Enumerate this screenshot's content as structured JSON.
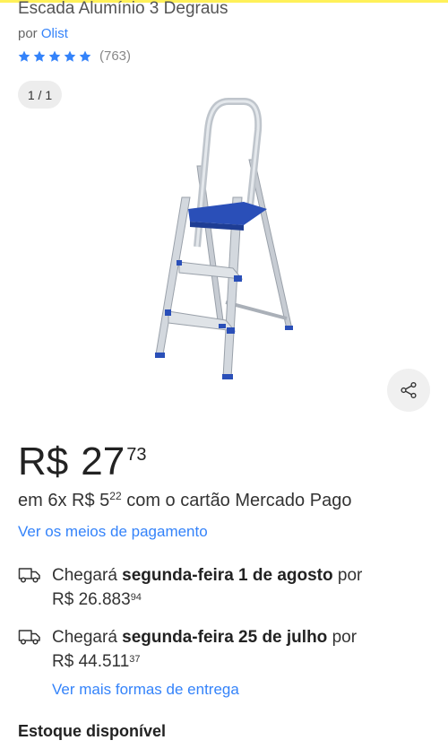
{
  "header": {
    "title": "Escada Alumínio 3 Degraus",
    "seller_prefix": "por",
    "seller_name": "Olist",
    "rating_count": "(763)",
    "stars": 5,
    "accent_color": "#fff159"
  },
  "gallery": {
    "counter": "1 / 1",
    "share_icon": "share-icon"
  },
  "price": {
    "currency": "R$",
    "integer": "27",
    "cents": "73"
  },
  "installments": {
    "prefix": "em 6x R$",
    "value_int": "5",
    "value_cents": "22",
    "suffix": "com o cartão Mercado Pago"
  },
  "payment_link": "Ver os meios de pagamento",
  "shipping": [
    {
      "icon": "truck-icon",
      "prefix": "Chegará",
      "date": "segunda-feira 1 de agosto",
      "by": "por",
      "price_int": "R$ 26.883",
      "price_cents": "94"
    },
    {
      "icon": "truck-icon",
      "prefix": "Chegará",
      "date": "segunda-feira 25 de julho",
      "by": "por",
      "price_int": "R$ 44.511",
      "price_cents": "37"
    }
  ],
  "more_delivery_link": "Ver mais formas de entrega",
  "stock": "Estoque disponível",
  "colors": {
    "link": "#3483fa",
    "star": "#3483fa",
    "step_blue": "#2a4fb8"
  }
}
